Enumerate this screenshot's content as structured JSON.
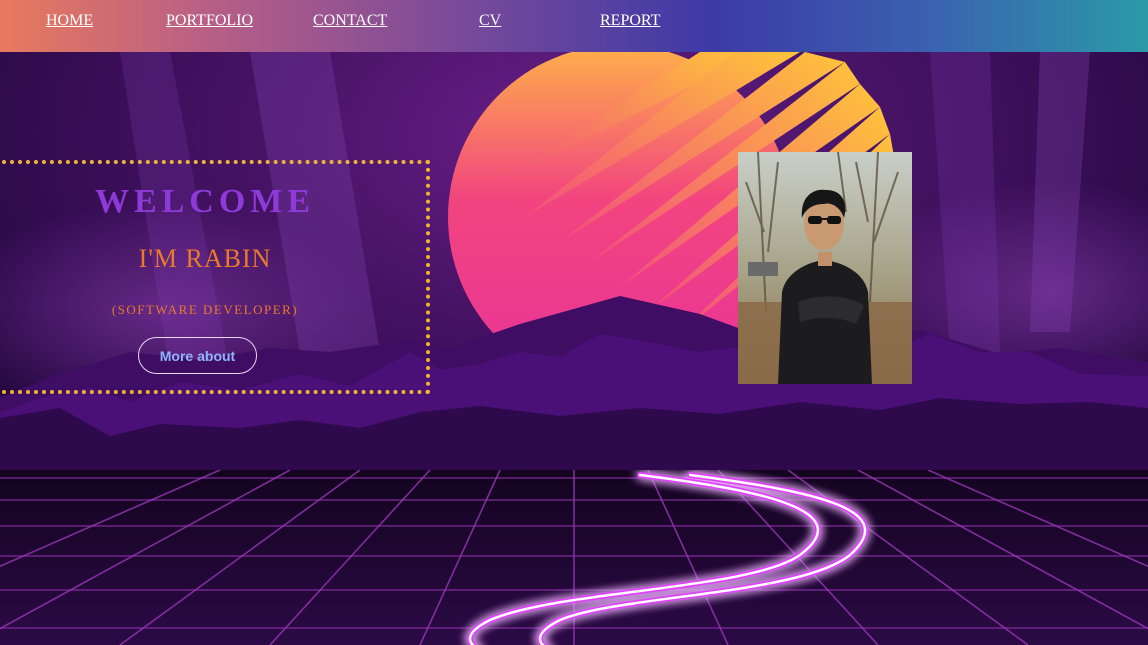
{
  "nav": {
    "items": [
      {
        "label": "HOME"
      },
      {
        "label": "PORTFOLIO"
      },
      {
        "label": "CONTACT"
      },
      {
        "label": "CV"
      },
      {
        "label": "REPORT"
      }
    ]
  },
  "hero": {
    "welcome": "WELCOME",
    "name": "I'M RABIN",
    "role": "(SOFTWARE DEVELOPER)",
    "button_label": "More about"
  },
  "colors": {
    "welcome": "#8e3ad8",
    "name": "#ea7a2a",
    "dotted_border": "#f0b435",
    "button_text": "#8fb4ff",
    "neon": "#e040fb"
  },
  "icons": [
    "retro-sun",
    "mountains",
    "neon-grid",
    "neon-road",
    "profile-photo"
  ]
}
